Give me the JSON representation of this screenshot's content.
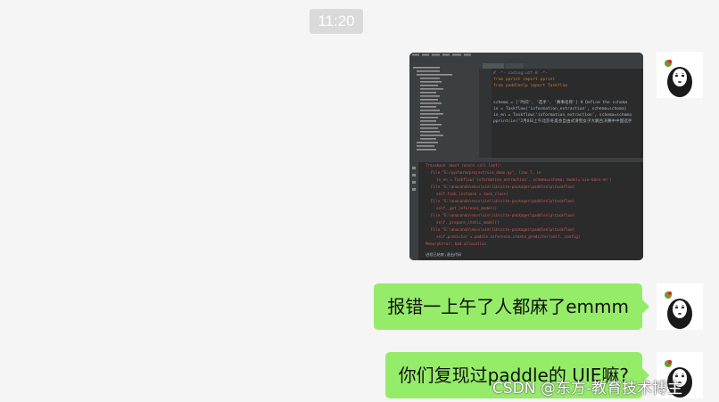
{
  "chat": {
    "timestamp": "11:20",
    "messages": [
      {
        "type": "image",
        "sender": "self",
        "caption": "IDE screenshot showing a Python traceback"
      },
      {
        "type": "text",
        "sender": "self",
        "text": "报错一上午了人都麻了emmm"
      },
      {
        "type": "text",
        "sender": "self",
        "text": "你们复现过paddle的 UIE嘛?"
      }
    ]
  },
  "screenshot": {
    "code_lines": [
      "# -*- coding:utf-8 -*-",
      "from pprint import pprint",
      "from paddlenlp import Taskflow",
      "schema = ['时间', '选手', '赛事名称'] # Define the schema",
      "ie = Taskflow('information_extraction', schema=schema)",
      "ie_en = Taskflow('information_extraction', schema=schema",
      "pprint(ie(\"2月8日上午北京冬奥会自由式滑雪女子大跳台决赛中中国选手"
    ],
    "error_lines": [
      "Traceback (most recent call last):",
      "File \"E:/pycharm/project/uie_demo.py\", line 7, in",
      "ie_en = Taskflow('information_extraction', schema=schema, model='uie-base-en')",
      "File \"E:\\anaconda\\envs\\uie\\lib\\site-packages\\paddlenlp\\taskflow\\",
      "self.task_instance = task_class(",
      "File \"E:\\anaconda\\envs\\uie\\lib\\site-packages\\paddlenlp\\taskflow\\",
      "self._get_inference_model()",
      "File \"E:\\anaconda\\envs\\uie\\lib\\site-packages\\paddlenlp\\taskflow\\",
      "self._prepare_static_model()",
      "File \"E:\\anaconda\\envs\\uie\\lib\\site-packages\\paddlenlp\\taskflow\\",
      "self.predictor = paddle.inference.create_predictor(self._config)",
      "MemoryError: bad allocation",
      "进程已结束,退出代码"
    ]
  },
  "watermark": "CSDN @东方-教育技术博主",
  "colors": {
    "background": "#f5f5f5",
    "bubble": "#95ec69",
    "timestamp_bg": "#dadada"
  }
}
